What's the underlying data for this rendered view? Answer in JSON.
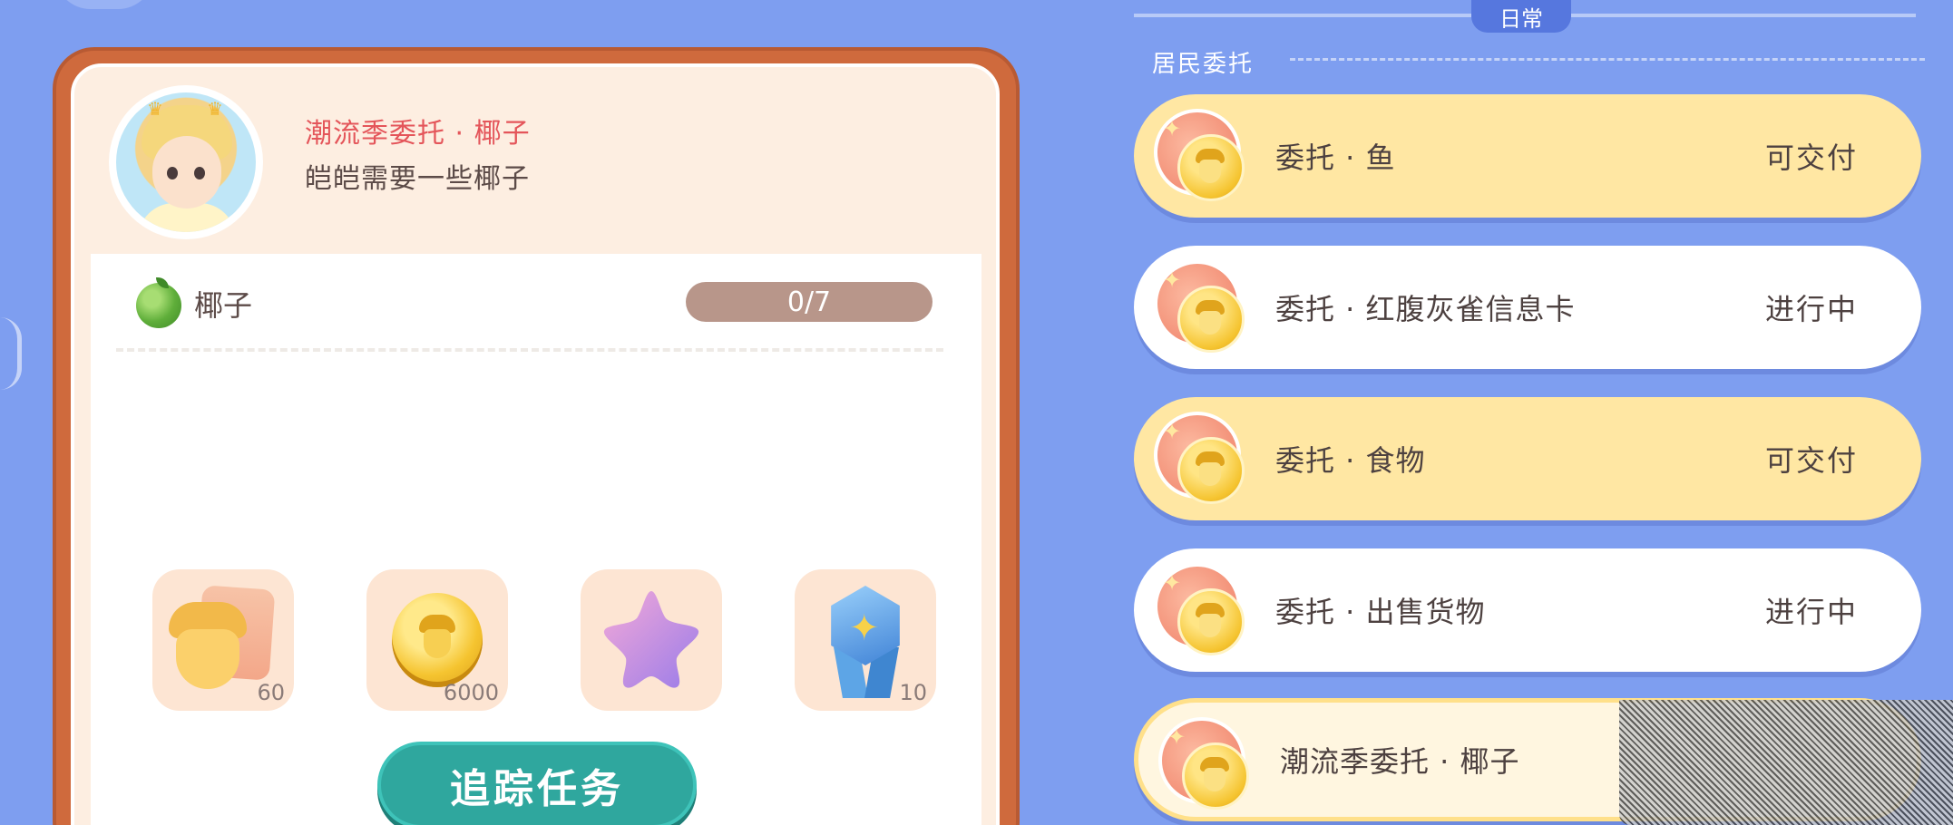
{
  "detail": {
    "title": "潮流季委托 · 椰子",
    "description": "皑皑需要一些椰子",
    "requirement": {
      "item": "椰子",
      "icon": "coconut-icon",
      "current": 0,
      "total": 7,
      "progress_text": "0/7"
    },
    "rewards": [
      {
        "icon": "acorn-card-icon",
        "count": "60"
      },
      {
        "icon": "acorn-coin-icon",
        "count": "6000"
      },
      {
        "icon": "purple-star-icon",
        "count": ""
      },
      {
        "icon": "blue-badge-icon",
        "count": "10"
      }
    ],
    "track_button": "追踪任务"
  },
  "sidebar": {
    "tab_label": "日常",
    "section_title": "居民委托",
    "quests": [
      {
        "name": "委托 · 鱼",
        "status": "可交付",
        "state": "deliverable"
      },
      {
        "name": "委托 · 红腹灰雀信息卡",
        "status": "进行中",
        "state": "progressing"
      },
      {
        "name": "委托 · 食物",
        "status": "可交付",
        "state": "deliverable"
      },
      {
        "name": "委托 · 出售货物",
        "status": "进行中",
        "state": "progressing"
      },
      {
        "name": "潮流季委托 · 椰子",
        "status": "",
        "state": "active"
      }
    ]
  },
  "colors": {
    "background": "#7e9ef0",
    "card_border": "#cf6a3d",
    "title_red": "#e4555a",
    "button_teal": "#2fa79e",
    "deliverable_yellow": "#ffe7a3"
  }
}
